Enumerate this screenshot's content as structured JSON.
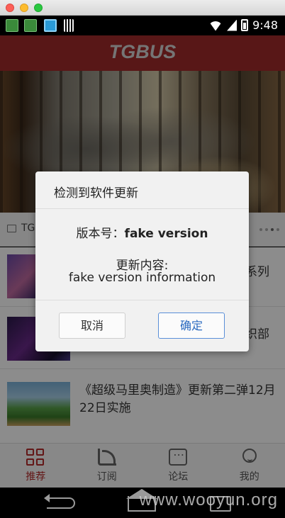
{
  "status_bar": {
    "time": "9:48"
  },
  "app": {
    "logo": "TGBUS"
  },
  "source_row": {
    "text": "TG"
  },
  "news": [
    {
      "title": "",
      "tail": "系列"
    },
    {
      "title": "",
      "tail": "织部"
    },
    {
      "title": "《超级马里奥制造》更新第二弹12月22日实施",
      "tail": ""
    }
  ],
  "tabs": [
    {
      "label": "推荐",
      "icon": "grid-icon",
      "active": true
    },
    {
      "label": "订阅",
      "icon": "rss-icon",
      "active": false
    },
    {
      "label": "论坛",
      "icon": "chat-icon",
      "active": false
    },
    {
      "label": "我的",
      "icon": "user-icon",
      "active": false
    }
  ],
  "dialog": {
    "title": "检测到软件更新",
    "version_label": "版本号：",
    "version_value": "fake version",
    "content_label": "更新内容:",
    "content_value": "fake version information",
    "cancel_label": "取消",
    "ok_label": "确定"
  },
  "watermark": "www.wooyun.org",
  "colors": {
    "header": "#a12a2a",
    "active_tab": "#b52a2a",
    "ok_button_text": "#2a6ac0"
  }
}
